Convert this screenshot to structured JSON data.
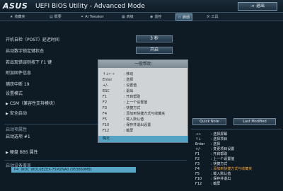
{
  "header": {
    "logo": "ASUS",
    "title": "UEFI BIOS Utility - Advanced Mode",
    "exit_label": "退出"
  },
  "tabs": [
    {
      "icon": "★",
      "label": "收藏夹"
    },
    {
      "icon": "▤",
      "label": "概要"
    },
    {
      "icon": "✦",
      "label": "Ai Tweaker"
    },
    {
      "icon": "▦",
      "label": "高级"
    },
    {
      "icon": "◉",
      "label": "监控"
    },
    {
      "icon": "⏻",
      "label": "启动"
    },
    {
      "icon": "⚒",
      "label": "工具"
    }
  ],
  "settings": [
    {
      "label": "开机自检（POST）延迟时间",
      "value": "3 秒"
    },
    {
      "label": "启动数字锁定键状态",
      "value": "开启"
    },
    {
      "label": "若出现错误则按下 F1 键",
      "value": ""
    },
    {
      "label": "附加固件信息",
      "value": ""
    },
    {
      "label": "捕获中断 19",
      "value": ""
    },
    {
      "label": "设置模式",
      "value": ""
    },
    {
      "label": "CSM（兼容性支持模块）",
      "value": ""
    },
    {
      "label": "安全启动",
      "value": ""
    }
  ],
  "section_boot": {
    "title": "启动项属性",
    "item1": "启动选项 #1"
  },
  "bbs_label": "硬盘 BBS 属性",
  "override_title": "启动设备覆盖",
  "boot_device": "P4: WDC WD10EZEX-75M2NA0 (953869MB)",
  "help_popup": {
    "title": "一般帮助",
    "lines": [
      {
        "key": "↑↓←→",
        "desc": "移动"
      },
      {
        "key": "Enter",
        "desc": "选择"
      },
      {
        "key": "+/-",
        "desc": "设置值"
      },
      {
        "key": "ESC",
        "desc": "退出"
      },
      {
        "key": "F1",
        "desc": "开启帮助"
      },
      {
        "key": "F2",
        "desc": "上一个设置值"
      },
      {
        "key": "F3",
        "desc": "快捷方式"
      },
      {
        "key": "F4",
        "desc": "添加到快捷方式与收藏夹"
      },
      {
        "key": "F5",
        "desc": "载入默认值"
      },
      {
        "key": "F10",
        "desc": "保存并退出设置"
      },
      {
        "key": "F12",
        "desc": "截屏"
      }
    ],
    "ok_label": "确定"
  },
  "quick_note_label": "Quick Note",
  "last_modified_label": "Last Modified",
  "right_help": [
    {
      "key": "→←",
      "desc": "选择屏幕"
    },
    {
      "key": "↑↓",
      "desc": "选择项目"
    },
    {
      "key": "Enter",
      "desc": "选择"
    },
    {
      "key": "+/-",
      "desc": "变更项目设置"
    },
    {
      "key": "F1",
      "desc": "开启帮助"
    },
    {
      "key": "F2",
      "desc": "上一个设置值"
    },
    {
      "key": "F3",
      "desc": "快捷方式"
    },
    {
      "key": "F4",
      "desc": "添加到快捷方式与收藏夹"
    },
    {
      "key": "F5",
      "desc": "载入默认值"
    },
    {
      "key": "F10",
      "desc": "保存并退出"
    },
    {
      "key": "F12",
      "desc": "截屏"
    }
  ],
  "colors": {
    "highlight": "#f0a43a",
    "selected": "#59a7c8"
  }
}
